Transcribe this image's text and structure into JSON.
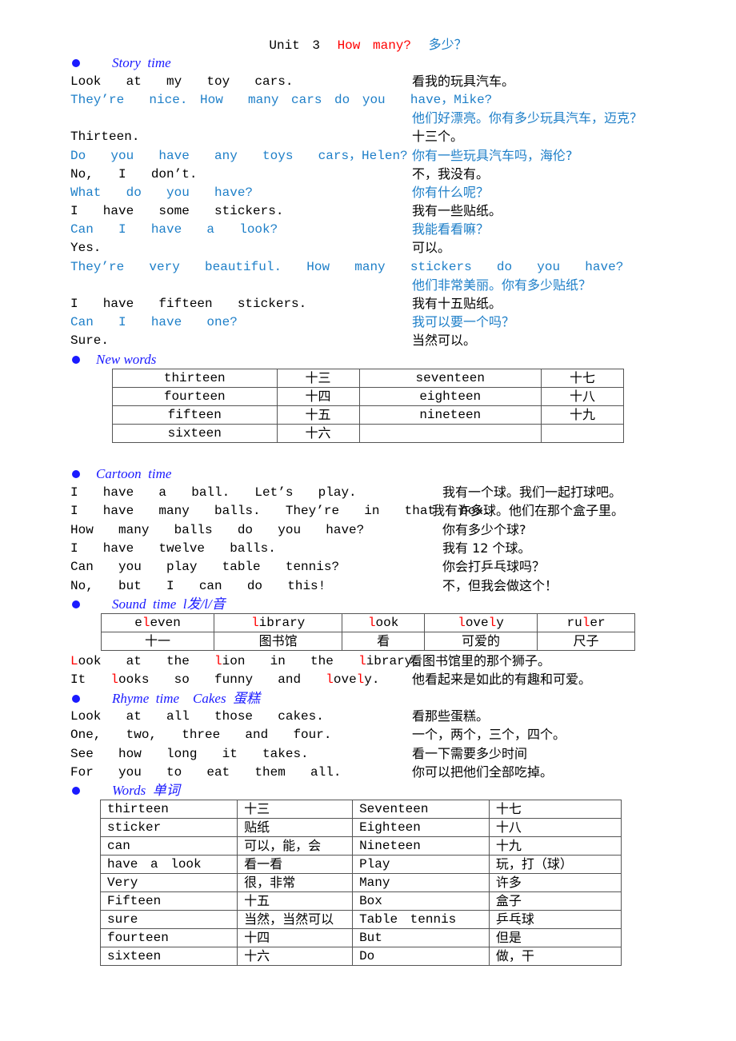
{
  "title": {
    "unit": "Unit  3",
    "en": "How  many?",
    "zh": "多少？"
  },
  "colors": {
    "accent_blue": "#1e7fc8",
    "heading_blue": "#1a1aff",
    "highlight_red": "#ff0000"
  },
  "story": {
    "heading": "Story  time",
    "lines": [
      {
        "en": "Look  at  my  toy  cars.",
        "zh": "看我的玩具汽车。",
        "color": "black"
      },
      {
        "en": "They’re  nice. How  many cars do you  have，Mike?",
        "zh": "他们好漂亮。你有多少玩具汽车，迈克？",
        "color": "blue"
      },
      {
        "en": "Thirteen.",
        "zh": "十三个。",
        "color": "black"
      },
      {
        "en": "Do  you  have  any  toys  cars，Helen?",
        "zh": "你有一些玩具汽车吗，海伦?",
        "color": "blue"
      },
      {
        "en": "No,  I  don’t.",
        "zh": "不，我没有。",
        "color": "black"
      },
      {
        "en": "What  do  you  have?",
        "zh": "你有什么呢？",
        "color": "blue"
      },
      {
        "en": "I  have  some  stickers.",
        "zh": "我有一些贴纸。",
        "color": "black"
      },
      {
        "en": "Can  I  have  a  look?",
        "zh": "我能看看嘛？",
        "color": "blue"
      },
      {
        "en": "Yes.",
        "zh": "可以。",
        "color": "black"
      },
      {
        "en": "They’re  very  beautiful.  How  many  stickers  do  you  have?",
        "zh": "他们非常美丽。你有多少贴纸？",
        "color": "blue"
      },
      {
        "en": "I  have  fifteen  stickers.",
        "zh": "我有十五贴纸。",
        "color": "black"
      },
      {
        "en": "Can  I  have  one?",
        "zh": "我可以要一个吗？",
        "color": "blue"
      },
      {
        "en": "Sure.",
        "zh": "当然可以。",
        "color": "black"
      }
    ]
  },
  "new_words": {
    "heading": "New words",
    "rows": [
      [
        "thirteen",
        "十三",
        "seventeen",
        "十七"
      ],
      [
        "fourteen",
        "十四",
        "eighteen",
        "十八"
      ],
      [
        "fifteen",
        "十五",
        "nineteen",
        "十九"
      ],
      [
        "sixteen",
        "十六",
        "",
        ""
      ]
    ]
  },
  "cartoon": {
    "heading": "Cartoon  time",
    "lines": [
      {
        "en": "I  have  a  ball.  Let’s  play.",
        "zh": "我有一个球。我们一起打球吧。"
      },
      {
        "en": "I  have  many  balls.  They’re  in  that  box.",
        "zh": "我有许多球。他们在那个盒子里。"
      },
      {
        "en": "How  many  balls  do  you  have?",
        "zh": "你有多少个球?"
      },
      {
        "en": "I  have  twelve  balls.",
        "zh": "我有 12 个球。"
      },
      {
        "en": "Can  you  play  table  tennis?",
        "zh": "你会打乒乓球吗？"
      },
      {
        "en": "No,  but  I  can  do  this!",
        "zh": "不，但我会做这个！"
      }
    ]
  },
  "sound": {
    "heading": "Sound  time  l发/l/音",
    "words": [
      {
        "parts": [
          [
            "e",
            false
          ],
          [
            "l",
            true
          ],
          [
            "even",
            false
          ]
        ]
      },
      {
        "parts": [
          [
            "l",
            true
          ],
          [
            "ibrary",
            false
          ]
        ]
      },
      {
        "parts": [
          [
            "l",
            true
          ],
          [
            "ook",
            false
          ]
        ]
      },
      {
        "parts": [
          [
            "l",
            true
          ],
          [
            "ove",
            false
          ],
          [
            "l",
            true
          ],
          [
            "y",
            false
          ]
        ]
      },
      {
        "parts": [
          [
            "ru",
            false
          ],
          [
            "l",
            true
          ],
          [
            "er",
            false
          ]
        ]
      }
    ],
    "meanings": [
      "十一",
      "图书馆",
      "看",
      "可爱的",
      "尺子"
    ],
    "sentences": [
      {
        "parts": [
          [
            "L",
            true
          ],
          [
            "ook  at  the  ",
            false
          ],
          [
            "l",
            true
          ],
          [
            "ion  in  the  ",
            false
          ],
          [
            "l",
            true
          ],
          [
            "ibrary.",
            false
          ]
        ],
        "zh": "看图书馆里的那个狮子。"
      },
      {
        "parts": [
          [
            "It  ",
            false
          ],
          [
            "l",
            true
          ],
          [
            "ooks  so  funny  and  ",
            false
          ],
          [
            "l",
            true
          ],
          [
            "ove",
            false
          ],
          [
            "l",
            true
          ],
          [
            "y.",
            false
          ]
        ],
        "zh": "他看起来是如此的有趣和可爱。"
      }
    ]
  },
  "rhyme": {
    "heading": "Rhyme  time    Cakes  蛋糕",
    "lines": [
      {
        "en": "Look  at  all  those  cakes.",
        "zh": "看那些蛋糕。"
      },
      {
        "en": "One,  two,  three  and  four.",
        "zh": "一个，两个，三个，四个。"
      },
      {
        "en": "See  how  long  it  takes.",
        "zh": "看一下需要多少时间"
      },
      {
        "en": "For  you  to  eat  them  all.",
        "zh": "你可以把他们全部吃掉。"
      }
    ]
  },
  "words": {
    "heading": "Words  单词",
    "rows": [
      [
        "thirteen",
        "十三",
        "Seventeen",
        "十七"
      ],
      [
        "sticker",
        "贴纸",
        "Eighteen",
        "十八"
      ],
      [
        "can",
        "可以，能，会",
        "Nineteen",
        "十九"
      ],
      [
        "have  a  look",
        "看一看",
        "Play",
        "玩，打（球）"
      ],
      [
        "Very",
        "很，非常",
        "Many",
        "许多"
      ],
      [
        "Fifteen",
        "十五",
        "Box",
        "盒子"
      ],
      [
        "sure",
        "当然，当然可以",
        "Table tennis",
        "乒乓球"
      ],
      [
        "fourteen",
        "十四",
        "But",
        "但是"
      ],
      [
        "sixteen",
        "十六",
        "Do",
        "做，干"
      ]
    ]
  }
}
